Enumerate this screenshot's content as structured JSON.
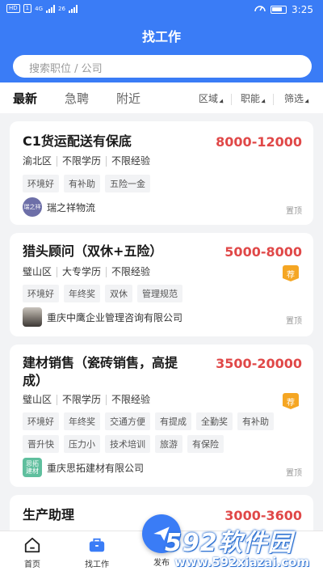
{
  "status_bar": {
    "left_chips": [
      "HD",
      "1",
      "4G",
      "26",
      "46"
    ],
    "time": "3:25"
  },
  "header": {
    "title": "找工作"
  },
  "search": {
    "placeholder": "搜索职位 / 公司"
  },
  "tabs": [
    {
      "label": "最新",
      "active": true
    },
    {
      "label": "急聘",
      "active": false
    },
    {
      "label": "附近",
      "active": false
    }
  ],
  "filters": [
    {
      "label": "区域"
    },
    {
      "label": "职能"
    },
    {
      "label": "筛选"
    }
  ],
  "jobs": [
    {
      "title": "C1货运配送有保底",
      "salary": "8000-12000",
      "requirements": [
        "渝北区",
        "不限学历",
        "不限经验"
      ],
      "tags": [
        "环境好",
        "有补助",
        "五险一金"
      ],
      "company": "瑞之祥物流",
      "logo_text": "瑞之祥",
      "pin_label": "置顶",
      "recommended": false
    },
    {
      "title": "猎头顾问（双休+五险）",
      "salary": "5000-8000",
      "requirements": [
        "璧山区",
        "大专学历",
        "不限经验"
      ],
      "tags": [
        "环境好",
        "年终奖",
        "双休",
        "管理规范"
      ],
      "company": "重庆中鹰企业管理咨询有限公司",
      "pin_label": "置顶",
      "recommended": true,
      "recommended_label": "荐"
    },
    {
      "title_line1": "建材销售（瓷砖销售，高提",
      "title_line2": "成）",
      "salary": "3500-20000",
      "requirements": [
        "璧山区",
        "不限学历",
        "不限经验"
      ],
      "tags": [
        "环境好",
        "年终奖",
        "交通方便",
        "有提成",
        "全勤奖",
        "有补助",
        "晋升快",
        "压力小",
        "技术培训",
        "旅游",
        "有保险"
      ],
      "company": "重庆思拓建材有限公司",
      "logo_text": "思拓建材",
      "pin_label": "置顶",
      "recommended": true,
      "recommended_label": "荐"
    },
    {
      "title": "生产助理",
      "salary": "3000-3600"
    }
  ],
  "bottom_nav": [
    {
      "label": "首页",
      "icon": "home-icon"
    },
    {
      "label": "找工作",
      "icon": "briefcase-icon"
    },
    {
      "label": "发布",
      "icon": "paper-plane-icon"
    }
  ],
  "watermark": {
    "logo": "592软件园",
    "url": "www.592xiazai.com"
  },
  "colors": {
    "brand": "#3a7cf6",
    "salary": "#e04848",
    "recommend": "#f5a623"
  }
}
